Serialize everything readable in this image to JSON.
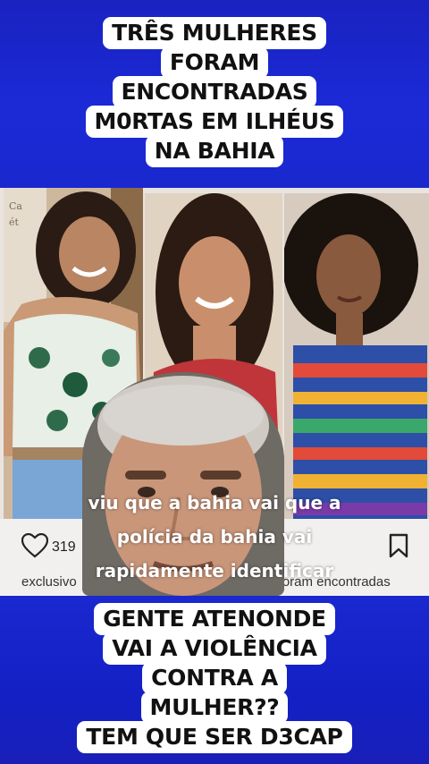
{
  "top_caption": {
    "lines": [
      "TRÊS MULHERES",
      "FORAM",
      "ENCONTRADAS",
      "M0RTAS EM ILHÉUS",
      "NA BAHIA"
    ]
  },
  "video": {
    "sign_letters": [
      "Ca",
      "ét"
    ],
    "subtitles": [
      "viu que a bahia vai que a",
      "polícia da bahia vai",
      "rapidamente identificar"
    ],
    "post": {
      "likes": "319",
      "caption_left": "exclusivo",
      "caption_right": "s foram encontradas"
    }
  },
  "bottom_caption": {
    "lines": [
      "GENTE ATENONDE",
      "VAI A VIOLÊNCIA",
      "CONTRA A",
      "MULHER??",
      "TEM QUE SER D3CAP"
    ]
  },
  "icons": {
    "like": "heart-outline-icon",
    "save": "bookmark-outline-icon"
  },
  "colors": {
    "background": "#1624c8",
    "caption_bg": "#ffffff",
    "caption_text": "#111111"
  }
}
